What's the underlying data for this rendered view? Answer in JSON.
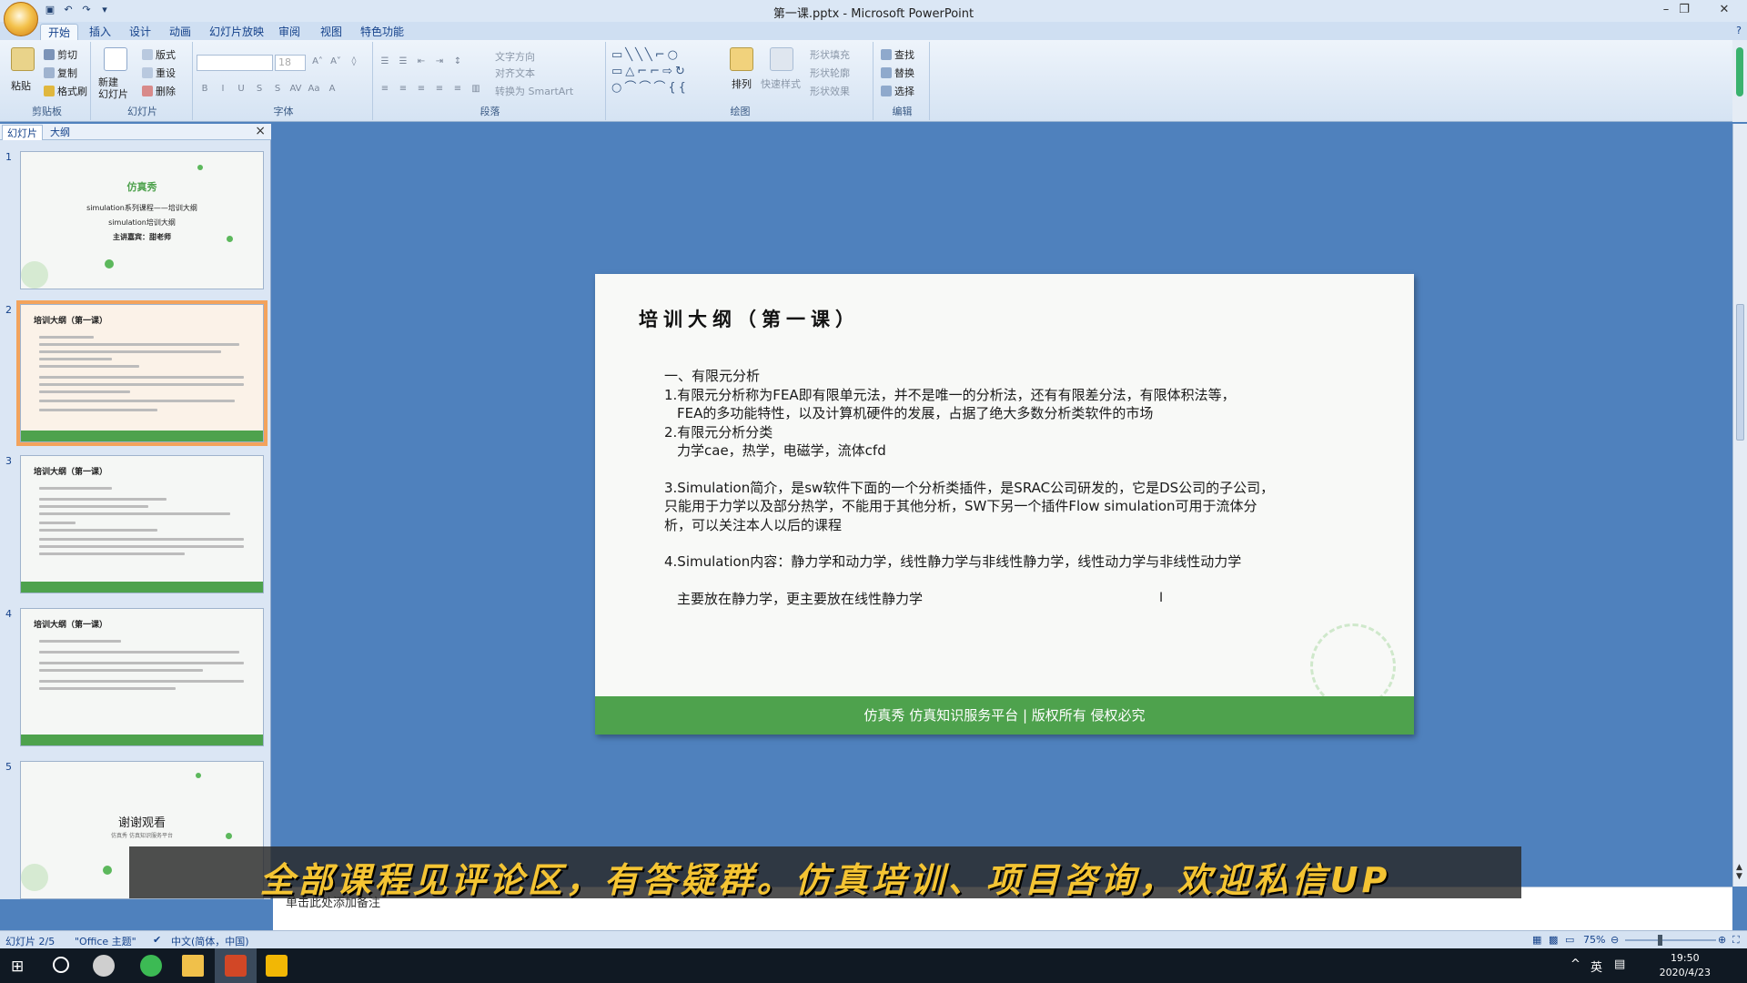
{
  "window": {
    "title": "第一课.pptx - Microsoft PowerPoint"
  },
  "ribbon_tabs": [
    "开始",
    "插入",
    "设计",
    "动画",
    "幻灯片放映",
    "审阅",
    "视图",
    "特色功能"
  ],
  "ribbon": {
    "clipboard": {
      "paste": "粘贴",
      "cut": "剪切",
      "copy": "复制",
      "format_painter": "格式刷",
      "label": "剪贴板"
    },
    "slides": {
      "new_slide": "新建\n幻灯片",
      "layout": "版式",
      "reset": "重设",
      "delete": "删除",
      "label": "幻灯片"
    },
    "font": {
      "size": "18",
      "label": "字体"
    },
    "paragraph": {
      "text_direction": "文字方向",
      "align_text": "对齐文本",
      "smartart": "转换为 SmartArt",
      "label": "段落"
    },
    "drawing": {
      "arrange": "排列",
      "quick_styles": "快速样式",
      "shape_fill": "形状填充",
      "shape_outline": "形状轮廓",
      "shape_effects": "形状效果",
      "label": "绘图"
    },
    "editing": {
      "find": "查找",
      "replace": "替换",
      "select": "选择",
      "label": "编辑"
    }
  },
  "left_panel": {
    "tab_slides": "幻灯片",
    "tab_outline": "大纲",
    "close": "×"
  },
  "thumbnails": [
    {
      "num": "1",
      "brand": "仿真秀",
      "line1": "simulation系列课程——培训大纲",
      "line2": "simulation培训大纲",
      "line3": "主讲嘉宾：甜老师"
    },
    {
      "num": "2",
      "title": "培训大纲（第一课）"
    },
    {
      "num": "3",
      "title": "培训大纲（第一课）"
    },
    {
      "num": "4",
      "title": "培训大纲（第一课）"
    },
    {
      "num": "5",
      "title": "谢谢观看",
      "sub": "仿真秀 仿真知识服务平台"
    }
  ],
  "slide": {
    "title": "培训大纲（第一课）",
    "lines": [
      "一、有限元分析",
      "1.有限元分析称为FEA即有限单元法，并不是唯一的分析法，还有有限差分法，有限体积法等，",
      "FEA的多功能特性，以及计算机硬件的发展，占据了绝大多数分析类软件的市场",
      "2.有限元分析分类",
      "力学cae，热学，电磁学，流体cfd",
      "3.Simulation简介，是sw软件下面的一个分析类插件，是SRAC公司研发的，它是DS公司的子公司，",
      "只能用于力学以及部分热学，不能用于其他分析，SW下另一个插件Flow simulation可用于流体分",
      "析，可以关注本人以后的课程",
      "4.Simulation内容：静力学和动力学，线性静力学与非线性静力学，线性动力学与非线性动力学",
      "主要放在静力学，更主要放在线性静力学"
    ],
    "footer": "仿真秀   仿真知识服务平台 | 版权所有 侵权必究"
  },
  "notes": {
    "placeholder": "单击此处添加备注"
  },
  "banner": {
    "text": "全部课程见评论区，有答疑群。仿真培训、项目咨询，欢迎私信UP"
  },
  "status": {
    "slide_pos": "幻灯片 2/5",
    "theme": "\"Office 主题\"",
    "language": "中文(简体，中国)",
    "zoom": "75%"
  },
  "taskbar": {
    "time": "19:50",
    "date": "2020/4/23",
    "ime": "英"
  }
}
